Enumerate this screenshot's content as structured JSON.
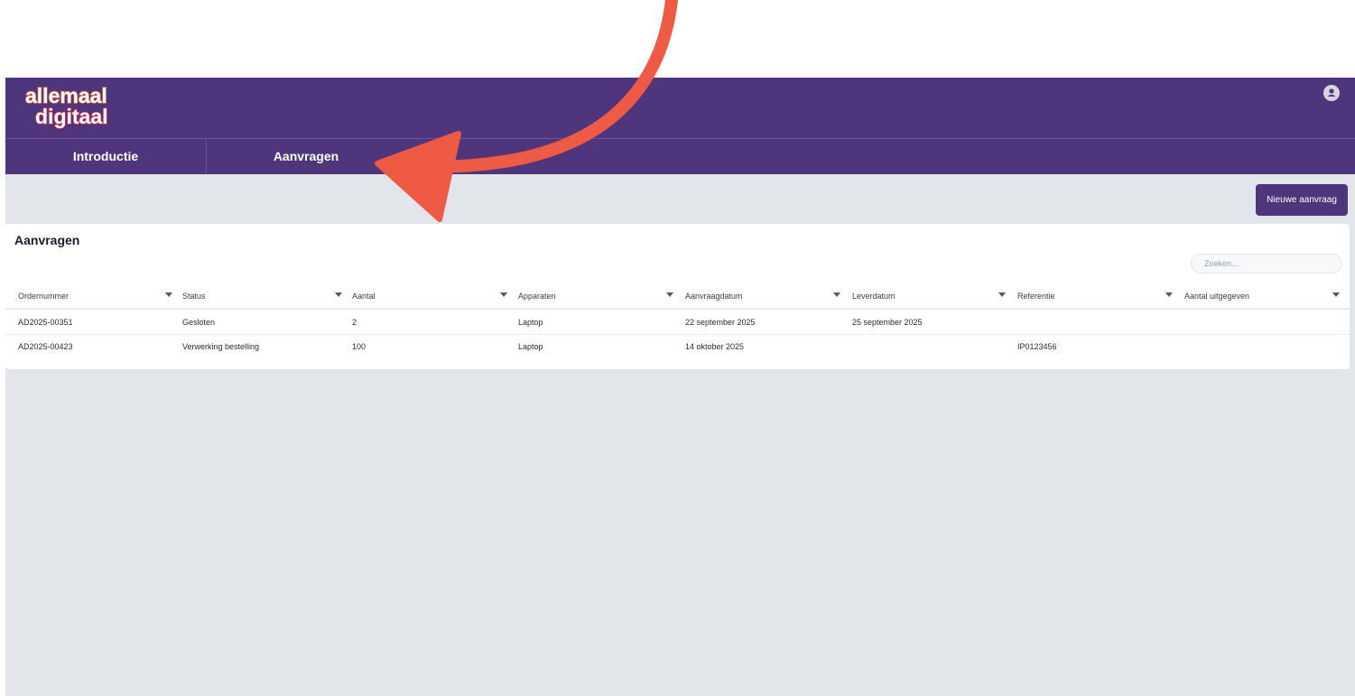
{
  "header": {
    "logo_text_line1": "allemaal",
    "logo_text_line2": "digitaal",
    "avatar_icon": "user-icon"
  },
  "nav": {
    "tabs": [
      {
        "label": "Introductie"
      },
      {
        "label": "Aanvragen"
      }
    ]
  },
  "toolbar": {
    "new_request_label": "Nieuwe aanvraag"
  },
  "requests": {
    "title": "Aanvragen",
    "search_placeholder": "Zoeken...",
    "columns": [
      "Ordernummer",
      "Status",
      "Aantal",
      "Apparaten",
      "Aanvraagdatum",
      "Leverdatum",
      "Referentie",
      "Aantal uitgegeven"
    ],
    "rows": [
      [
        "AD2025-00351",
        "Gesloten",
        "2",
        "Laptop",
        "22 september 2025",
        "25 september 2025",
        "",
        ""
      ],
      [
        "AD2025-00423",
        "Verwerking bestelling",
        "100",
        "Laptop",
        "14 oktober 2025",
        "",
        "IP0123456",
        ""
      ]
    ]
  },
  "colors": {
    "brand_purple": "#4f357c",
    "background": "#e2e6ea",
    "annotation_arrow": "#ee5a44",
    "logo_orange": "#f06a3a",
    "logo_red": "#e8344a"
  }
}
